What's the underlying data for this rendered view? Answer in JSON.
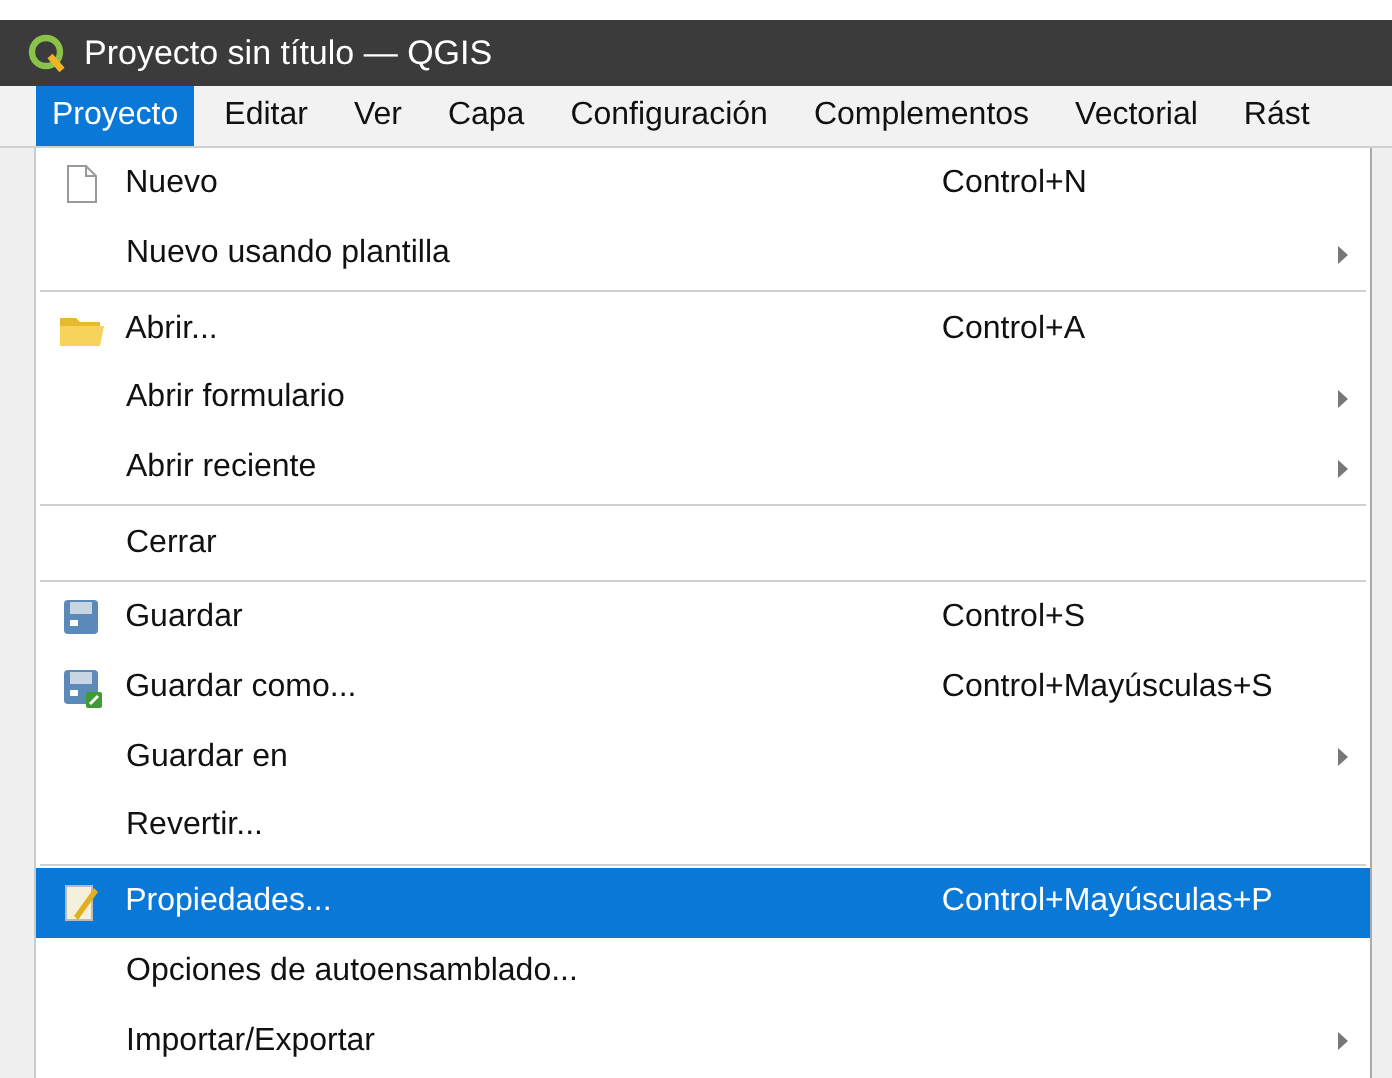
{
  "window": {
    "title": "Proyecto sin título — QGIS"
  },
  "menubar": [
    {
      "label": "Proyecto",
      "selected": true
    },
    {
      "label": "Editar",
      "selected": false
    },
    {
      "label": "Ver",
      "selected": false
    },
    {
      "label": "Capa",
      "selected": false
    },
    {
      "label": "Configuración",
      "selected": false
    },
    {
      "label": "Complementos",
      "selected": false
    },
    {
      "label": "Vectorial",
      "selected": false
    },
    {
      "label": "Rást",
      "selected": false
    }
  ],
  "menu": [
    {
      "kind": "item",
      "label": "Nuevo",
      "shortcut": "Control+N",
      "submenu": false,
      "selected": false
    },
    {
      "kind": "item",
      "label": "Nuevo usando plantilla",
      "submenu": true,
      "selected": false
    },
    {
      "kind": "separator"
    },
    {
      "kind": "item",
      "label": "Abrir...",
      "shortcut": "Control+A",
      "submenu": false,
      "selected": false
    },
    {
      "kind": "item",
      "label": "Abrir formulario",
      "submenu": true,
      "selected": false
    },
    {
      "kind": "item",
      "label": "Abrir reciente",
      "submenu": true,
      "selected": false
    },
    {
      "kind": "separator"
    },
    {
      "kind": "item",
      "label": "Cerrar",
      "submenu": false,
      "selected": false
    },
    {
      "kind": "separator"
    },
    {
      "kind": "item",
      "label": "Guardar",
      "shortcut": "Control+S",
      "submenu": false,
      "selected": false
    },
    {
      "kind": "item",
      "label": "Guardar como...",
      "shortcut": "Control+Mayúsculas+S",
      "submenu": false,
      "selected": false
    },
    {
      "kind": "item",
      "label": "Guardar en",
      "submenu": true,
      "selected": false
    },
    {
      "kind": "item",
      "label": "Revertir...",
      "submenu": false,
      "selected": false
    },
    {
      "kind": "separator"
    },
    {
      "kind": "item",
      "label": "Propiedades...",
      "shortcut": "Control+Mayúsculas+P",
      "submenu": false,
      "selected": true
    },
    {
      "kind": "item",
      "label": "Opciones de autoensamblado...",
      "submenu": false,
      "selected": false
    },
    {
      "kind": "item",
      "label": "Importar/Exportar",
      "submenu": true,
      "selected": false
    }
  ]
}
